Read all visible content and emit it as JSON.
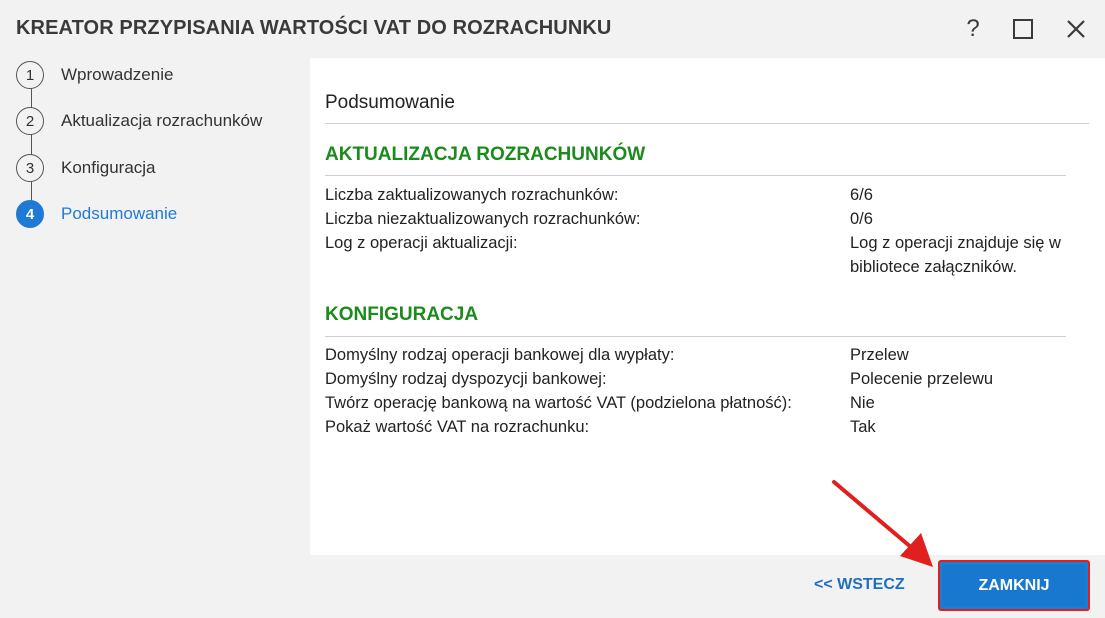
{
  "window": {
    "title": "KREATOR PRZYPISANIA WARTOŚCI VAT DO ROZRACHUNKU",
    "help_glyph": "?",
    "icons": [
      "help-icon",
      "maximize-icon",
      "close-icon"
    ]
  },
  "steps": [
    {
      "number": "1",
      "label": "Wprowadzenie",
      "active": false
    },
    {
      "number": "2",
      "label": "Aktualizacja rozrachunków",
      "active": false
    },
    {
      "number": "3",
      "label": "Konfiguracja",
      "active": false
    },
    {
      "number": "4",
      "label": "Podsumowanie",
      "active": true
    }
  ],
  "summary": {
    "title": "Podsumowanie",
    "update_section": {
      "title": "AKTUALIZACJA ROZRACHUNKÓW",
      "rows": [
        {
          "label": "Liczba zaktualizowanych rozrachunków:",
          "value": "6/6"
        },
        {
          "label": "Liczba niezaktualizowanych rozrachunków:",
          "value": "0/6"
        },
        {
          "label": "Log z operacji aktualizacji:",
          "value": "Log z operacji znajduje się w bibliotece załączników."
        }
      ]
    },
    "config_section": {
      "title": "KONFIGURACJA",
      "rows": [
        {
          "label": "Domyślny rodzaj operacji bankowej dla wypłaty:",
          "value": "Przelew"
        },
        {
          "label": "Domyślny rodzaj dyspozycji bankowej:",
          "value": "Polecenie przelewu"
        },
        {
          "label": "Twórz operację bankową na wartość VAT (podzielona płatność):",
          "value": "Nie"
        },
        {
          "label": "Pokaż wartość VAT na rozrachunku:",
          "value": "Tak"
        }
      ]
    }
  },
  "footer": {
    "back_label": "<< WSTECZ",
    "close_label": "ZAMKNIJ"
  },
  "colors": {
    "accent": "#1f7ad6",
    "section": "#1c8a1c",
    "highlight": "#e0201e"
  }
}
